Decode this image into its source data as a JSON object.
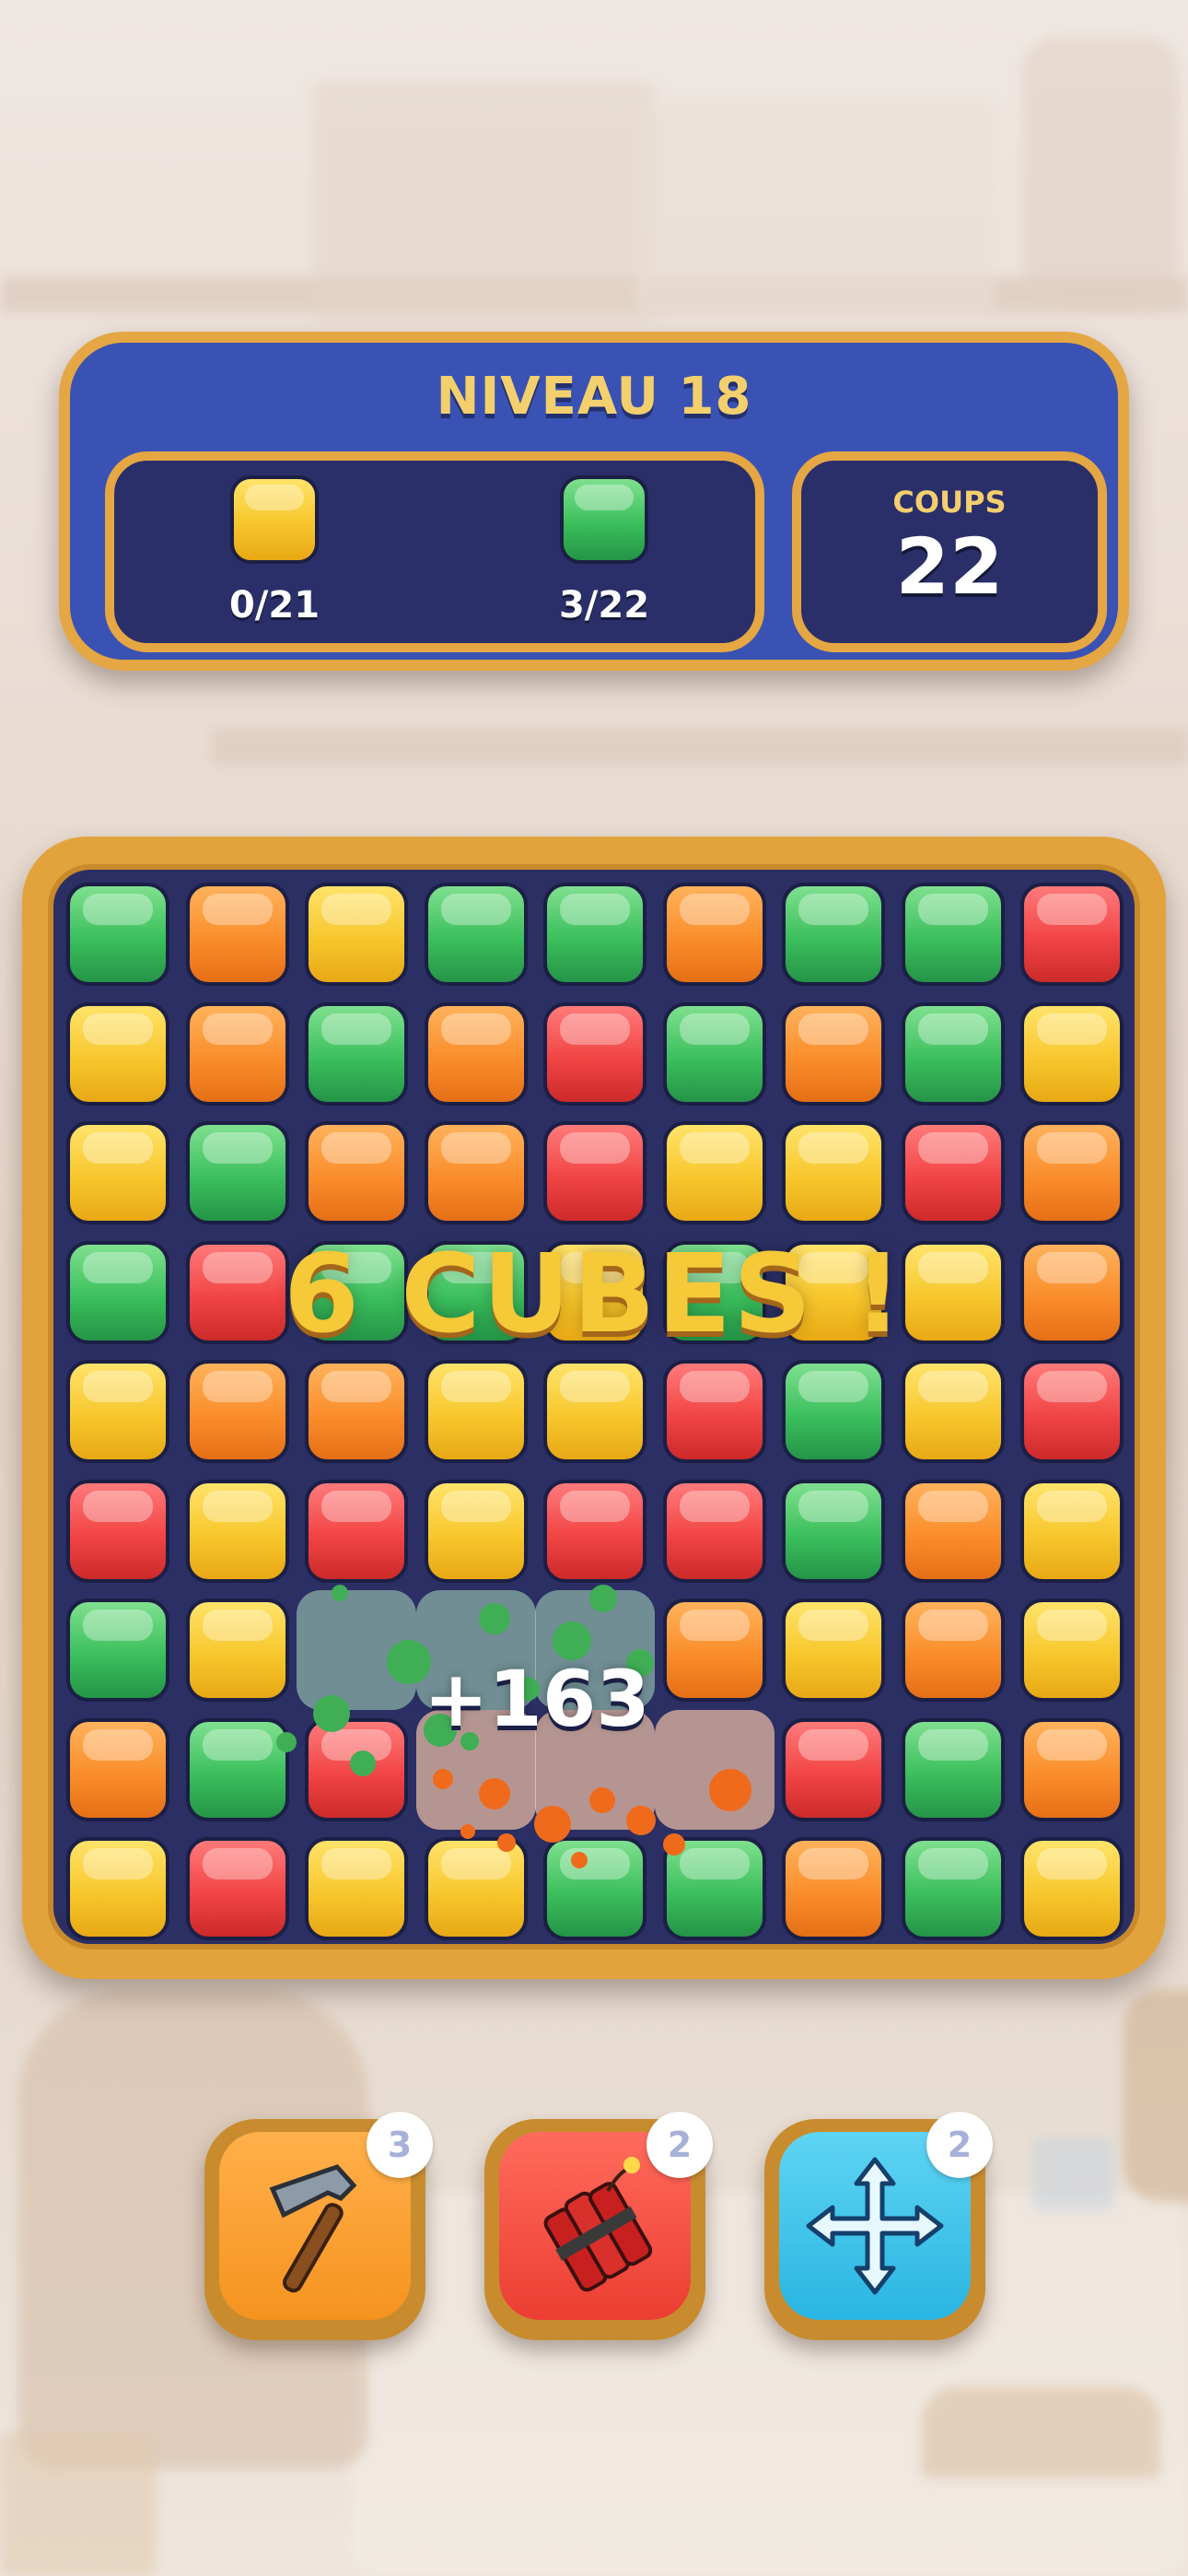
{
  "header": {
    "level_label": "NIVEAU 18",
    "goals": [
      {
        "color": "yellow",
        "progress": "0/21"
      },
      {
        "color": "green",
        "progress": "3/22"
      }
    ],
    "moves_label": "COUPS",
    "moves_value": "22"
  },
  "board": {
    "rows": 9,
    "cols": 9,
    "grid": [
      [
        "green",
        "orange",
        "yellow",
        "green",
        "green",
        "orange",
        "green",
        "green",
        "red"
      ],
      [
        "yellow",
        "orange",
        "green",
        "orange",
        "red",
        "green",
        "orange",
        "green",
        "yellow"
      ],
      [
        "yellow",
        "green",
        "orange",
        "orange",
        "red",
        "yellow",
        "yellow",
        "red",
        "orange"
      ],
      [
        "green",
        "red",
        "green",
        "green",
        "yellow",
        "green",
        "yellow",
        "yellow",
        "orange"
      ],
      [
        "yellow",
        "orange",
        "orange",
        "yellow",
        "yellow",
        "red",
        "green",
        "yellow",
        "red"
      ],
      [
        "red",
        "yellow",
        "red",
        "yellow",
        "red",
        "red",
        "green",
        "orange",
        "yellow"
      ],
      [
        "green",
        "yellow",
        "empty",
        "empty",
        "empty",
        "orange",
        "yellow",
        "orange",
        "yellow"
      ],
      [
        "orange",
        "green",
        "red",
        "empty",
        "empty",
        "empty",
        "red",
        "green",
        "orange"
      ],
      [
        "yellow",
        "red",
        "yellow",
        "yellow",
        "green",
        "green",
        "orange",
        "green",
        "yellow"
      ]
    ]
  },
  "effects": {
    "combo_text": "6 CUBES !",
    "score_popup": "+163"
  },
  "boosters": [
    {
      "name": "hammer",
      "count": "3",
      "icon": "hammer-icon"
    },
    {
      "name": "dynamite",
      "count": "2",
      "icon": "dynamite-icon"
    },
    {
      "name": "move",
      "count": "2",
      "icon": "move-arrows-icon"
    }
  ],
  "colors": {
    "panel_blue": "#3a52b3",
    "frame_gold": "#e5a743",
    "board_navy": "#2b2f63",
    "title_yellow": "#f3cf6e"
  }
}
